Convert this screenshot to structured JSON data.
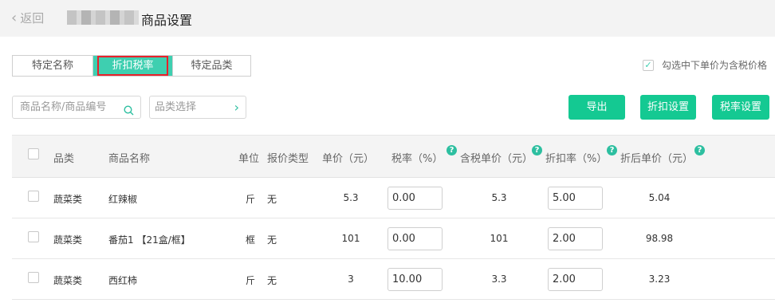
{
  "header": {
    "back_label": "返回",
    "title": "商品设置"
  },
  "tabs": [
    {
      "label": "特定名称"
    },
    {
      "label": "折扣税率"
    },
    {
      "label": "特定品类"
    }
  ],
  "tax_checkbox": {
    "label": "勾选中下单价为含税价格",
    "checked": true
  },
  "filters": {
    "search_placeholder": "商品名称/商品编号",
    "category_placeholder": "品类选择"
  },
  "buttons": {
    "export": "导出",
    "discount": "折扣设置",
    "tax": "税率设置"
  },
  "columns": {
    "category": "品类",
    "name": "商品名称",
    "unit": "单位",
    "price_type": "报价类型",
    "price": "单价（元）",
    "tax_rate": "税率（%）",
    "tax_price": "含税单价（元）",
    "discount": "折扣率（%）",
    "discounted_price": "折后单价（元）"
  },
  "rows": [
    {
      "category": "蔬菜类",
      "name": "红辣椒",
      "unit": "斤",
      "price_type": "无",
      "price": "5.3",
      "tax_rate": "0.00",
      "tax_price": "5.3",
      "discount": "5.00",
      "discounted_price": "5.04"
    },
    {
      "category": "蔬菜类",
      "name": "番茄1 【21盒/框】",
      "unit": "框",
      "price_type": "无",
      "price": "101",
      "tax_rate": "0.00",
      "tax_price": "101",
      "discount": "2.00",
      "discounted_price": "98.98"
    },
    {
      "category": "蔬菜类",
      "name": "西红柿",
      "unit": "斤",
      "price_type": "无",
      "price": "3",
      "tax_rate": "10.00",
      "tax_price": "3.3",
      "discount": "2.00",
      "discounted_price": "3.23"
    }
  ],
  "icons": {
    "back": "chevron-left-icon",
    "search": "search-icon",
    "category": "chevron-right-icon",
    "help": "question-icon"
  },
  "colors": {
    "accent": "#14c992",
    "active_tab": "#3ecfb0",
    "highlight_border": "#e8202a"
  }
}
